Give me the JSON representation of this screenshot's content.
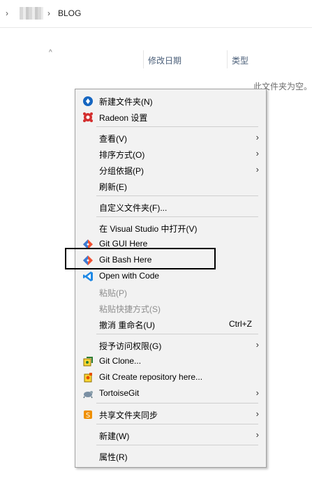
{
  "address": {
    "path": "BLOG"
  },
  "columns": {
    "date": "修改日期",
    "type": "类型"
  },
  "empty_text": "此文件夹为空。",
  "menu": {
    "new_folder": "新建文件夹(N)",
    "radeon": "Radeon 设置",
    "view": "查看(V)",
    "sort": "排序方式(O)",
    "group": "分组依据(P)",
    "refresh": "刷新(E)",
    "customize": "自定义文件夹(F)...",
    "open_vs": "在 Visual Studio 中打开(V)",
    "git_gui": "Git GUI Here",
    "git_bash": "Git Bash Here",
    "open_code": "Open with Code",
    "paste": "粘贴(P)",
    "paste_shortcut": "粘贴快捷方式(S)",
    "undo": "撤消 重命名(U)",
    "undo_shortcut": "Ctrl+Z",
    "grant_access": "授予访问权限(G)",
    "git_clone": "Git Clone...",
    "git_create": "Git Create repository here...",
    "tortoisegit": "TortoiseGit",
    "sync": "共享文件夹同步",
    "new": "新建(W)",
    "properties": "属性(R)"
  }
}
